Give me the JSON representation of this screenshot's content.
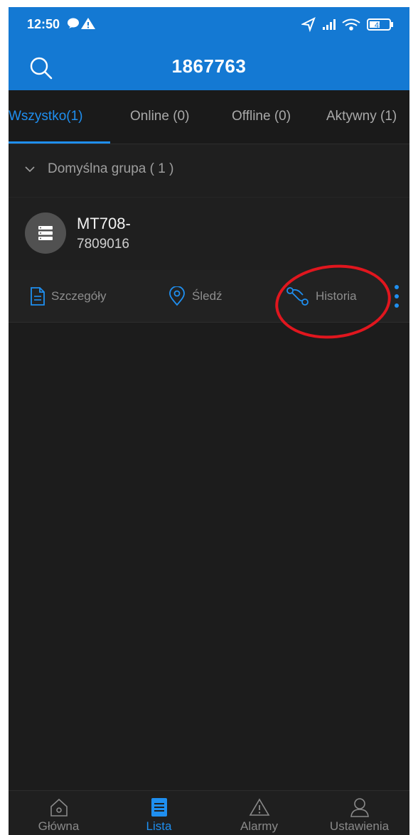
{
  "status_bar": {
    "time": "12:50",
    "battery": "45"
  },
  "header": {
    "title": "1867763"
  },
  "tabs": [
    {
      "label": "Wszystko(1)",
      "active": true
    },
    {
      "label": "Online (0)",
      "active": false
    },
    {
      "label": "Offline (0)",
      "active": false
    },
    {
      "label": "Aktywny (1)",
      "active": false
    }
  ],
  "group": {
    "label": "Domyślna grupa ( 1 )"
  },
  "device": {
    "name": "MT708-",
    "imei": "7809016"
  },
  "actions": [
    {
      "label": "Szczegóły",
      "icon": "document-icon"
    },
    {
      "label": "Śledź",
      "icon": "location-pin-icon"
    },
    {
      "label": "Historia",
      "icon": "route-icon"
    }
  ],
  "bottom_nav": [
    {
      "label": "Główna",
      "icon": "home-icon",
      "active": false
    },
    {
      "label": "Lista",
      "icon": "list-icon",
      "active": true
    },
    {
      "label": "Alarmy",
      "icon": "warning-icon",
      "active": false
    },
    {
      "label": "Ustawienia",
      "icon": "user-icon",
      "active": false
    }
  ],
  "colors": {
    "accent": "#1f8ff0",
    "header": "#1479d3",
    "background": "#1c1c1c",
    "highlight_circle": "#e0161e"
  }
}
